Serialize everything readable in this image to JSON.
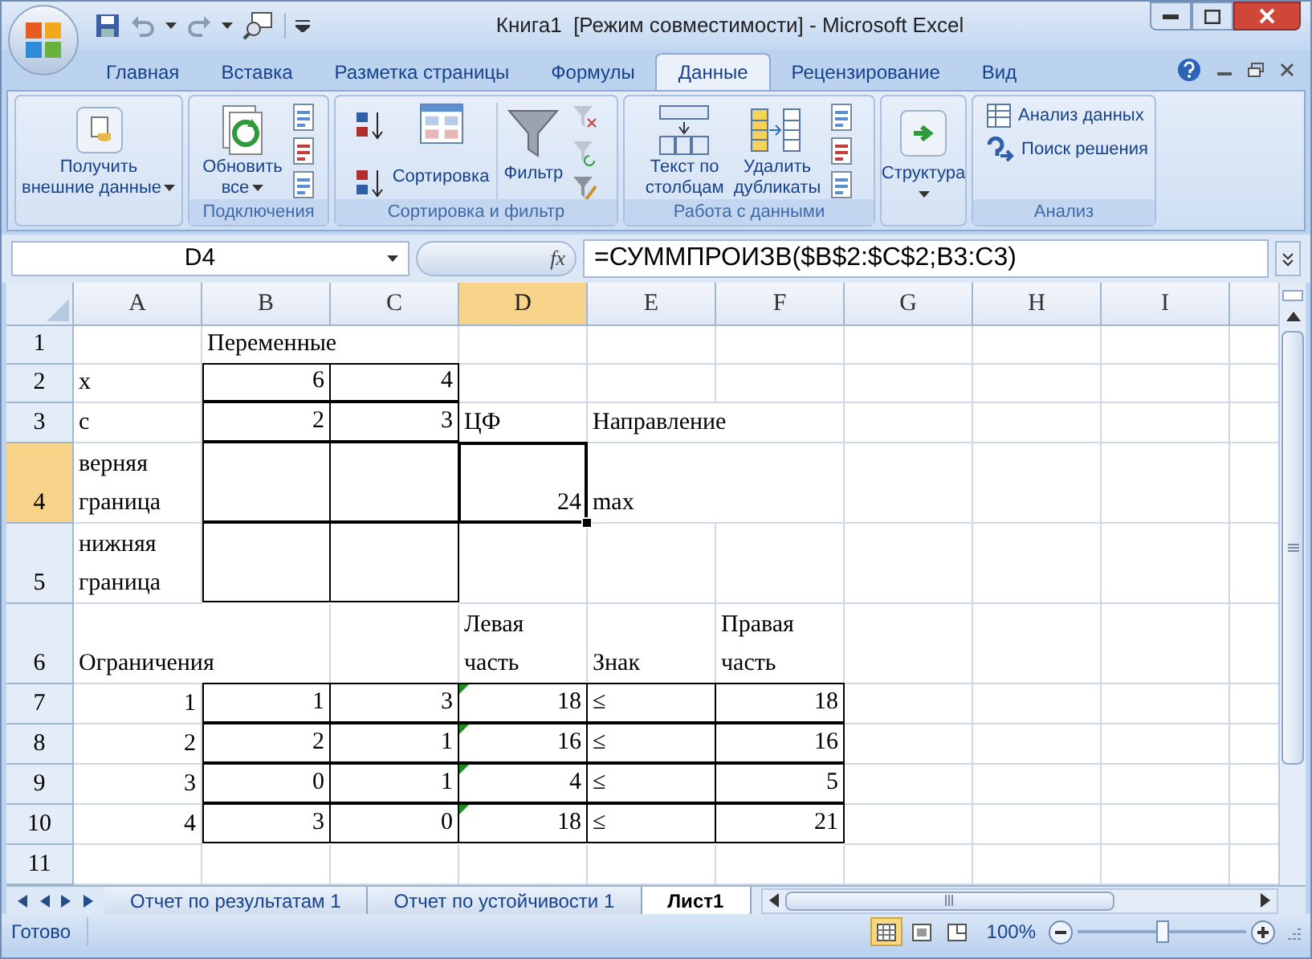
{
  "window": {
    "title": "Книга1  [Режим совместимости] - Microsoft Excel"
  },
  "ribbon_tabs": [
    {
      "label": "Главная",
      "selected": false
    },
    {
      "label": "Вставка",
      "selected": false
    },
    {
      "label": "Разметка страницы",
      "selected": false
    },
    {
      "label": "Формулы",
      "selected": false
    },
    {
      "label": "Данные",
      "selected": true
    },
    {
      "label": "Рецензирование",
      "selected": false
    },
    {
      "label": "Вид",
      "selected": false
    }
  ],
  "ribbon_groups": [
    {
      "items": [
        {
          "lines": [
            "Получить",
            "внешние данные"
          ],
          "kind": "large",
          "dropdown": true
        }
      ]
    },
    {
      "label": "Подключения",
      "items": [
        {
          "lines": [
            "Обновить",
            "все"
          ],
          "kind": "large",
          "dropdown": true
        }
      ]
    },
    {
      "label": "Сортировка и фильтр",
      "items": [
        {
          "lines": [
            "Сортировка"
          ],
          "kind": "inline"
        },
        {
          "lines": [
            "Фильтр"
          ],
          "kind": "large"
        }
      ]
    },
    {
      "label": "Работа с данными",
      "items": [
        {
          "lines": [
            "Текст по",
            "столбцам"
          ],
          "kind": "large"
        },
        {
          "lines": [
            "Удалить",
            "дубликаты"
          ],
          "kind": "large"
        }
      ]
    },
    {
      "items": [
        {
          "lines": [
            "Структура"
          ],
          "kind": "large",
          "dropdown": true
        }
      ]
    },
    {
      "label": "Анализ",
      "items": [
        {
          "lines": [
            "Анализ данных"
          ],
          "kind": "small"
        },
        {
          "lines": [
            "Поиск решения"
          ],
          "kind": "small"
        }
      ]
    }
  ],
  "formula_bar": {
    "name_box": "D4",
    "fx_label": "fx",
    "formula": "=СУММПРОИЗВ($B$2:$C$2;B3:C3)"
  },
  "columns": [
    {
      "label": "A",
      "selected": false
    },
    {
      "label": "B",
      "selected": false
    },
    {
      "label": "C",
      "selected": false
    },
    {
      "label": "D",
      "selected": true
    },
    {
      "label": "E",
      "selected": false
    },
    {
      "label": "F",
      "selected": false
    },
    {
      "label": "G",
      "selected": false
    },
    {
      "label": "H",
      "selected": false
    },
    {
      "label": "I",
      "selected": false
    }
  ],
  "rows": [
    {
      "header": "1",
      "selected": false,
      "cells": [
        null,
        {
          "text": "Переменные",
          "kind": "text"
        }
      ]
    },
    {
      "header": "2",
      "selected": false,
      "cells": [
        {
          "text": "x",
          "kind": "text"
        },
        {
          "text": "6",
          "kind": "number",
          "bordered": true
        },
        {
          "text": "4",
          "kind": "number",
          "bordered": true
        }
      ]
    },
    {
      "header": "3",
      "selected": false,
      "cells": [
        {
          "text": "c",
          "kind": "text"
        },
        {
          "text": "2",
          "kind": "number",
          "bordered": true
        },
        {
          "text": "3",
          "kind": "number",
          "bordered": true
        },
        {
          "text": "ЦФ",
          "kind": "text"
        },
        {
          "text": "Направление",
          "kind": "text"
        }
      ]
    },
    {
      "header": "4",
      "selected": true,
      "cells": [
        {
          "text": "верняя граница",
          "kind": "text",
          "wrap": true
        },
        {
          "kind": "text",
          "bordered": true
        },
        {
          "kind": "text",
          "bordered": true
        },
        {
          "text": "24",
          "kind": "number"
        },
        {
          "text": "max",
          "kind": "text"
        }
      ]
    },
    {
      "header": "5",
      "selected": false,
      "cells": [
        {
          "text": "нижняя граница",
          "kind": "text",
          "wrap": true
        },
        {
          "kind": "text",
          "bordered": true
        },
        {
          "kind": "text",
          "bordered": true
        }
      ]
    },
    {
      "header": "6",
      "selected": false,
      "cells": [
        {
          "text": "Ограничения",
          "kind": "text"
        },
        null,
        null,
        {
          "text": "Левая часть",
          "kind": "text",
          "wrap": true
        },
        {
          "text": "Знак",
          "kind": "text"
        },
        {
          "text": "Правая часть",
          "kind": "text",
          "wrap": true
        }
      ]
    },
    {
      "header": "7",
      "selected": false,
      "cells": [
        {
          "text": "1",
          "kind": "number"
        },
        {
          "text": "1",
          "kind": "number",
          "bordered": true
        },
        {
          "text": "3",
          "kind": "number",
          "bordered": true
        },
        {
          "text": "18",
          "kind": "number",
          "bordered": true,
          "error_mark": true
        },
        {
          "text": "≤",
          "kind": "text",
          "bordered": true
        },
        {
          "text": "18",
          "kind": "number",
          "bordered": true
        }
      ]
    },
    {
      "header": "8",
      "selected": false,
      "cells": [
        {
          "text": "2",
          "kind": "number"
        },
        {
          "text": "2",
          "kind": "number",
          "bordered": true
        },
        {
          "text": "1",
          "kind": "number",
          "bordered": true
        },
        {
          "text": "16",
          "kind": "number",
          "bordered": true,
          "error_mark": true
        },
        {
          "text": "≤",
          "kind": "text",
          "bordered": true
        },
        {
          "text": "16",
          "kind": "number",
          "bordered": true
        }
      ]
    },
    {
      "header": "9",
      "selected": false,
      "cells": [
        {
          "text": "3",
          "kind": "number"
        },
        {
          "text": "0",
          "kind": "number",
          "bordered": true
        },
        {
          "text": "1",
          "kind": "number",
          "bordered": true
        },
        {
          "text": "4",
          "kind": "number",
          "bordered": true,
          "error_mark": true
        },
        {
          "text": "≤",
          "kind": "text",
          "bordered": true
        },
        {
          "text": "5",
          "kind": "number",
          "bordered": true
        }
      ]
    },
    {
      "header": "10",
      "selected": false,
      "cells": [
        {
          "text": "4",
          "kind": "number"
        },
        {
          "text": "3",
          "kind": "number",
          "bordered": true
        },
        {
          "text": "0",
          "kind": "number",
          "bordered": true
        },
        {
          "text": "18",
          "kind": "number",
          "bordered": true,
          "error_mark": true
        },
        {
          "text": "≤",
          "kind": "text",
          "bordered": true
        },
        {
          "text": "21",
          "kind": "number",
          "bordered": true
        }
      ]
    },
    {
      "header": "11",
      "selected": false,
      "cells": []
    }
  ],
  "sheet_tabs": [
    {
      "label": "Отчет по результатам 1",
      "selected": false
    },
    {
      "label": "Отчет по устойчивости 1",
      "selected": false
    },
    {
      "label": "Лист1",
      "selected": true
    }
  ],
  "status_bar": {
    "status": "Готово",
    "view_buttons": [
      {
        "selected": true
      },
      {
        "selected": false
      },
      {
        "selected": false
      }
    ],
    "zoom": "100%",
    "zoom_slider": {
      "level": 0.5
    }
  }
}
